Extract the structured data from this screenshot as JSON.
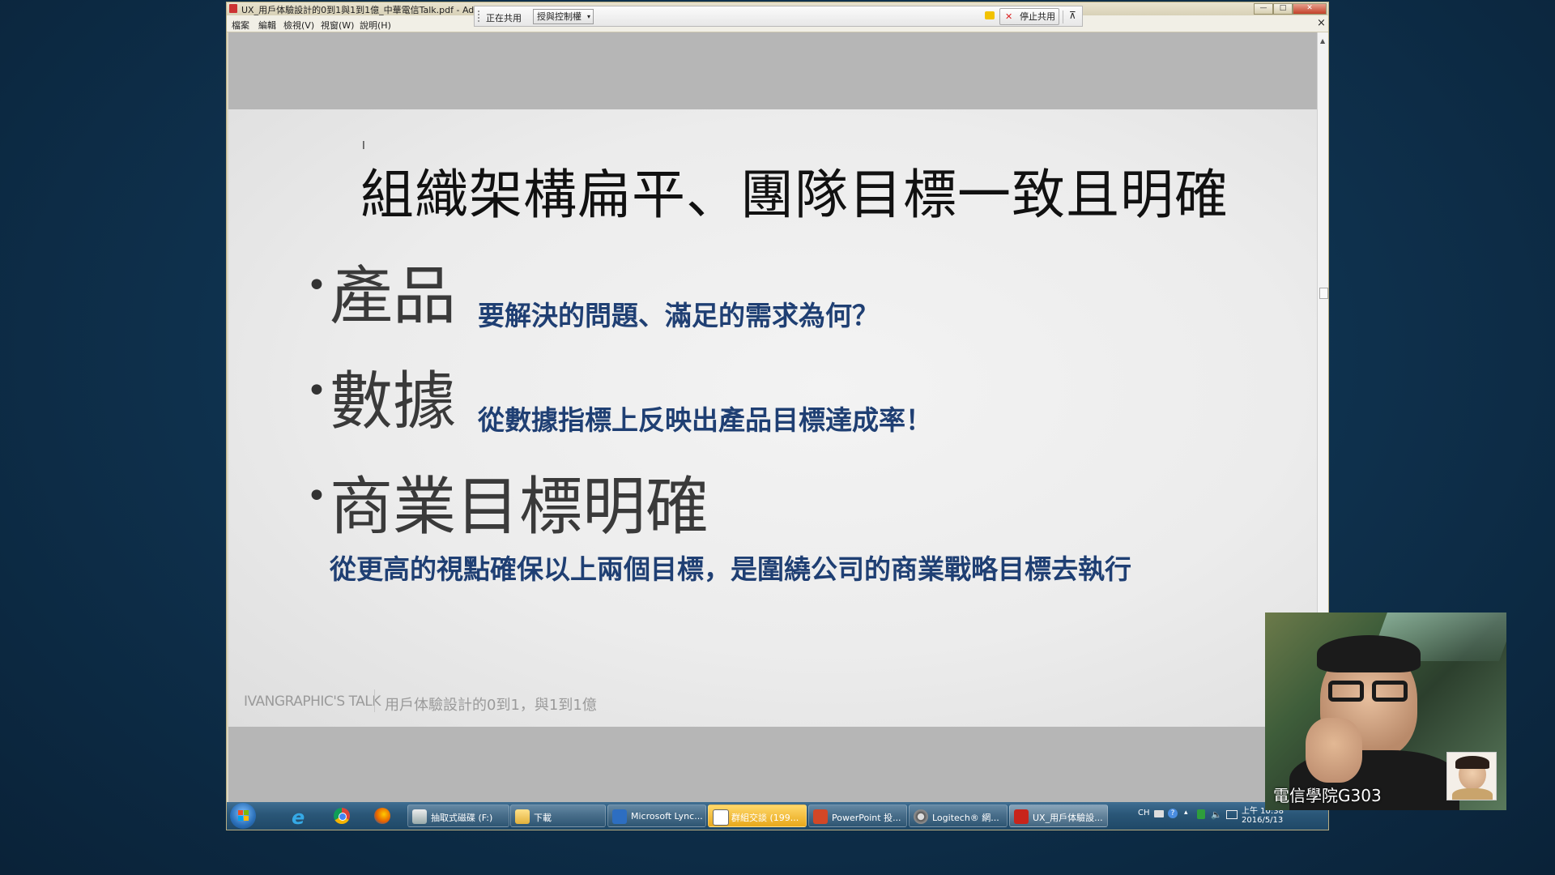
{
  "window": {
    "title": "UX_用戶体驗設計的0到1與1到1億_中華電信Talk.pdf - Adobe Reader",
    "min_glyph": "—",
    "max_glyph": "□",
    "close_glyph": "✕",
    "doc_close_glyph": "×"
  },
  "menu": {
    "items": [
      "檔案",
      "編輯",
      "檢視(V)",
      "視窗(W)",
      "說明(H)"
    ]
  },
  "share_toolbar": {
    "sharing_label": "正在共用",
    "control_label": "授與控制權",
    "stop_label": "停止共用",
    "pin_glyph": "⊼"
  },
  "slide": {
    "title": "組織架構扁平、團隊目標一致且明確",
    "bullet_char": "•",
    "bullets": [
      {
        "head": "產品",
        "sub": "要解決的問題、滿足的需求為何？"
      },
      {
        "head": "數據",
        "sub": "從數據指標上反映出產品目標達成率！"
      },
      {
        "head": "商業目標明確",
        "sub": "從更高的視點確保以上兩個目標，是圍繞公司的商業戰略目標去執行"
      }
    ],
    "footer_brand": "IVANGRAPHIC'S TALK",
    "footer_subtitle": "用戶体驗設計的0到1，與1到1億"
  },
  "taskbar": {
    "items": [
      {
        "label": "抽取式磁碟 (F:)"
      },
      {
        "label": "下載"
      },
      {
        "label": "Microsoft Lync..."
      },
      {
        "label": "群組交談 (199..."
      },
      {
        "label": "PowerPoint 投..."
      },
      {
        "label": "Logitech® 網..."
      },
      {
        "label": "UX_用戶体驗設..."
      }
    ],
    "tray": {
      "language": "CH",
      "time": "上午 10:38",
      "date": "2016/5/13"
    }
  },
  "webcam": {
    "label": "電信學院G303"
  },
  "colors": {
    "accent_blue": "#1f3f73",
    "title_black": "#111111",
    "bullet_gray": "#3a3a3a",
    "footer_gray": "#9a9a9a"
  }
}
